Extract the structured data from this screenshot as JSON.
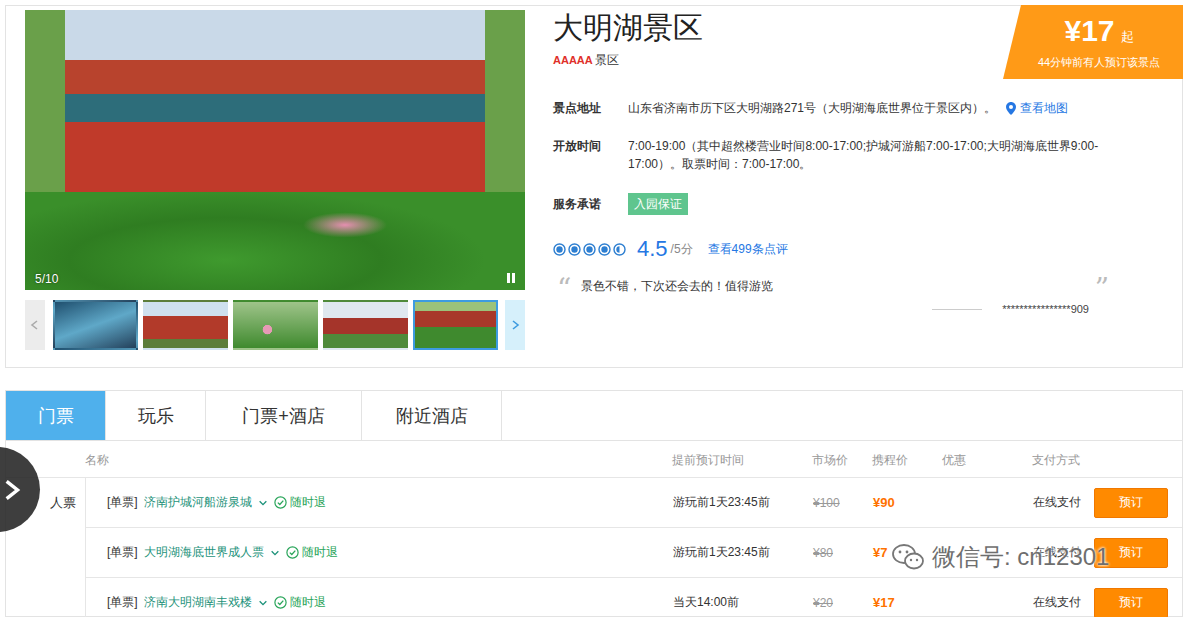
{
  "gallery": {
    "counter": "5/10",
    "thumbnails": [
      {
        "selected": false
      },
      {
        "selected": false
      },
      {
        "selected": false
      },
      {
        "selected": false
      },
      {
        "selected": true
      }
    ]
  },
  "title": "大明湖景区",
  "grade": "AAAAA",
  "grade_label": "景区",
  "price_badge": {
    "amount": "¥17",
    "suffix": "起",
    "note": "44分钟前有人预订该景点"
  },
  "info": [
    {
      "kind": "text",
      "label": "景点地址",
      "value": "山东省济南市历下区大明湖路271号（大明湖海底世界位于景区内）。",
      "link": "查看地图"
    },
    {
      "kind": "text",
      "label": "开放时间",
      "value": "7:00-19:00（其中超然楼营业时间8:00-17:00;护城河游船7:00-17:00;大明湖海底世界9:00-17:00）。取票时间：7:00-17:00。"
    },
    {
      "kind": "badge",
      "label": "服务承诺",
      "badge": "入园保证"
    }
  ],
  "rating": {
    "stars": 4.5,
    "score": "4.5",
    "max": "/5分",
    "reviews": "查看499条点评"
  },
  "quote": {
    "open": "“",
    "close": "”",
    "text": "景色不错，下次还会去的！值得游览",
    "user": "****************909"
  },
  "tabs": [
    {
      "label": "门票",
      "selected": true
    },
    {
      "label": "玩乐",
      "selected": false
    },
    {
      "label": "门票+酒店",
      "selected": false
    },
    {
      "label": "附近酒店",
      "selected": false
    }
  ],
  "table": {
    "columns": [
      "名称",
      "提前预订时间",
      "市场价",
      "携程价",
      "优惠",
      "支付方式"
    ],
    "category": "人票",
    "rows": [
      {
        "type": "[单票]",
        "name": "济南护城河船游泉城",
        "refund": "随时退",
        "deadline": "游玩前1天23:45前",
        "market_price": "¥100",
        "price": "¥90",
        "payment": "在线支付",
        "button": "预订"
      },
      {
        "type": "[单票]",
        "name": "大明湖海底世界成人票",
        "refund": "随时退",
        "deadline": "游玩前1天23:45前",
        "market_price": "¥80",
        "price": "¥7",
        "payment": "在线支付",
        "button": "预订"
      },
      {
        "type": "[单票]",
        "name": "济南大明湖南丰戏楼",
        "refund": "随时退",
        "deadline": "当天14:00前",
        "market_price": "¥20",
        "price": "¥17",
        "payment": "在线支付",
        "button": "预订"
      }
    ]
  },
  "watermark": "微信号: cn12301"
}
